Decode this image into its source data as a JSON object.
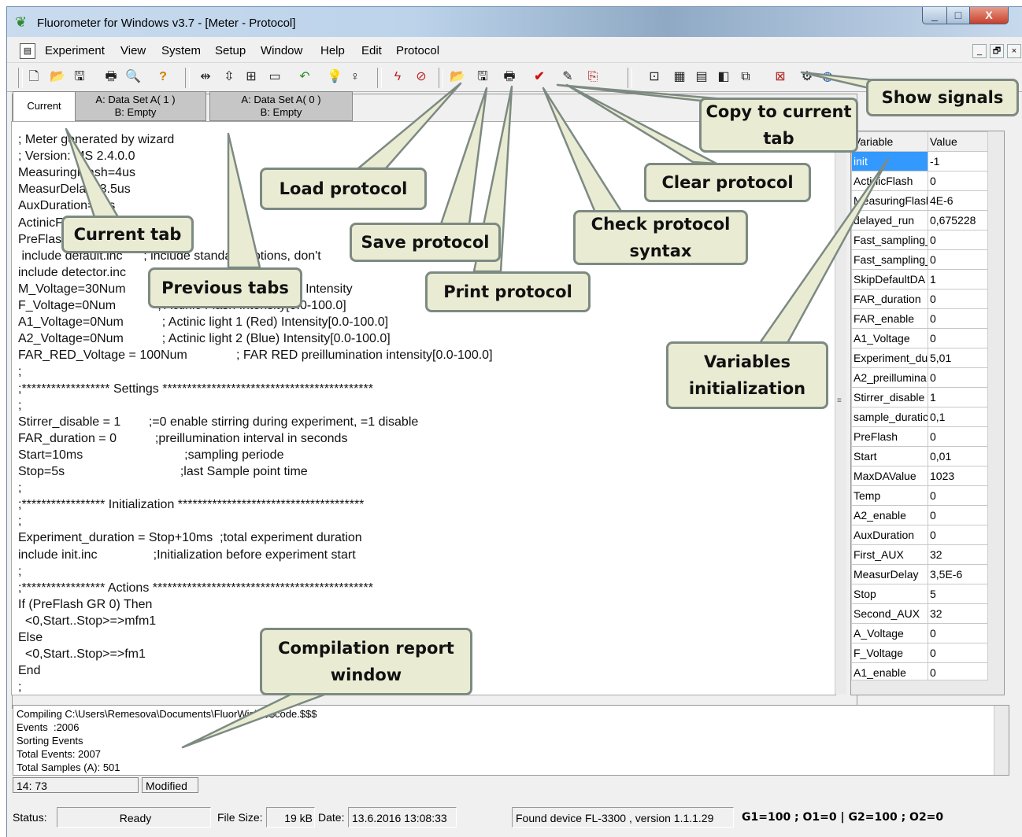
{
  "window": {
    "title": "Fluorometer for Windows v3.7 - [Meter - Protocol]",
    "controls": [
      "_",
      "□",
      "X"
    ]
  },
  "menu": {
    "items": [
      "Experiment",
      "View",
      "System",
      "Setup",
      "Window",
      "Help",
      "Edit",
      "Protocol"
    ],
    "mdi_controls": [
      "_",
      "🗗",
      "×"
    ]
  },
  "toolbar": {
    "icons": [
      "new-icon",
      "open-icon",
      "save-icon",
      "print-icon",
      "print-preview-icon",
      "help-icon",
      "fit-width-icon",
      "fit-height-icon",
      "zoom-icon",
      "window-icon",
      "undo-icon",
      "light-on-icon",
      "light-off-icon",
      "flash-icon",
      "stop-icon",
      "load-protocol-icon",
      "save-protocol-icon",
      "print-protocol-icon",
      "check-syntax-icon",
      "clear-protocol-icon",
      "copy-to-tab-icon",
      "graph-icon",
      "export-icon",
      "report-icon",
      "data-icon",
      "chart-icon",
      "signals-icon",
      "settings-icon",
      "globe-icon"
    ]
  },
  "tabs": [
    {
      "label": "Current"
    },
    {
      "label": "A: Data Set A( 1 )",
      "sub": "B: Empty"
    },
    {
      "label": "A: Data Set A( 0 )",
      "sub": "B: Empty"
    }
  ],
  "code": [
    "; Meter generated by wizard",
    "; Version: MS 2.4.0.0",
    "MeasuringFlash=4us",
    "MeasurDelay=3.5us",
    "AuxDuration=0us",
    "ActinicFlash=0",
    "PreFlash=0",
    " include default.inc      ; include standard options, don't",
    "include detector.inc",
    "M_Voltage=30Num          ; Measuring flash 1 (Red) Intensity",
    "F_Voltage=0Num            ; Actinic Flash Intensity[0.0-100.0]",
    "A1_Voltage=0Num           ; Actinic light 1 (Red) Intensity[0.0-100.0]",
    "A2_Voltage=0Num           ; Actinic light 2 (Blue) Intensity[0.0-100.0]",
    "FAR_RED_Voltage = 100Num              ; FAR RED preillumination intensity[0.0-100.0]",
    ";",
    ";****************** Settings *******************************************",
    ";",
    "Stirrer_disable = 1        ;=0 enable stirring during experiment, =1 disable",
    "FAR_duration = 0           ;preillumination interval in seconds",
    "Start=10ms                             ;sampling periode",
    "Stop=5s                                 ;last Sample point time",
    ";",
    ";***************** Initialization **************************************",
    ";",
    "Experiment_duration = Stop+10ms  ;total experiment duration",
    "include init.inc                ;Initialization before experiment start",
    ";",
    ";***************** Actions *********************************************",
    "If (PreFlash GR 0) Then",
    "  <0,Start..Stop>=>mfm1",
    "Else",
    "  <0,Start..Stop>=>fm1",
    "End",
    ";"
  ],
  "variables": {
    "headers": [
      "Variable",
      "Value"
    ],
    "rows": [
      [
        "init",
        "-1"
      ],
      [
        "ActinicFlash",
        "0"
      ],
      [
        "MeasuringFlash",
        "4E-6"
      ],
      [
        "delayed_run",
        "0,675228"
      ],
      [
        "Fast_sampling_",
        "0"
      ],
      [
        "Fast_sampling_",
        "0"
      ],
      [
        "SkipDefaultDA",
        "1"
      ],
      [
        "FAR_duration",
        "0"
      ],
      [
        "FAR_enable",
        "0"
      ],
      [
        "A1_Voltage",
        "0"
      ],
      [
        "Experiment_du",
        "5,01"
      ],
      [
        "A2_preillumina",
        "0"
      ],
      [
        "Stirrer_disable",
        "1"
      ],
      [
        "sample_duratic",
        "0,1"
      ],
      [
        "PreFlash",
        "0"
      ],
      [
        "Start",
        "0,01"
      ],
      [
        "MaxDAValue",
        "1023"
      ],
      [
        "Temp",
        "0"
      ],
      [
        "A2_enable",
        "0"
      ],
      [
        "AuxDuration",
        "0"
      ],
      [
        "First_AUX",
        "32"
      ],
      [
        "MeasurDelay",
        "3,5E-6"
      ],
      [
        "Stop",
        "5"
      ],
      [
        "Second_AUX",
        "32"
      ],
      [
        "A_Voltage",
        "0"
      ],
      [
        "F_Voltage",
        "0"
      ],
      [
        "A1_enable",
        "0"
      ]
    ]
  },
  "report": [
    "Compiling C:\\Users\\Remesova\\Documents\\FluorWin\\$$$code.$$$",
    "Events  :2006",
    "Sorting Events",
    "Total Events: 2007",
    "Total Samples (A): 501"
  ],
  "editor_status": {
    "position": "14:  73",
    "state": "Modified"
  },
  "statusbar": {
    "status_label": "Status:",
    "status_value": "Ready",
    "filesize_label": "File Size:",
    "filesize_value": "19 kB",
    "date_label": "Date:",
    "date_value": "13.6.2016 13:08:33",
    "device": "Found device FL-3300 , version 1.1.1.29",
    "channels": "G1=100 ; O1=0  |  G2=100 ; O2=0"
  },
  "callouts": {
    "show_signals": "Show signals",
    "copy_to_tab": "Copy to current tab",
    "clear_protocol": "Clear protocol",
    "load_protocol": "Load protocol",
    "check_syntax": "Check protocol syntax",
    "save_protocol": "Save protocol",
    "current_tab": "Current tab",
    "previous_tabs": "Previous tabs",
    "print_protocol": "Print protocol",
    "variables_init": "Variables initialization",
    "compilation_report": "Compilation report window"
  }
}
